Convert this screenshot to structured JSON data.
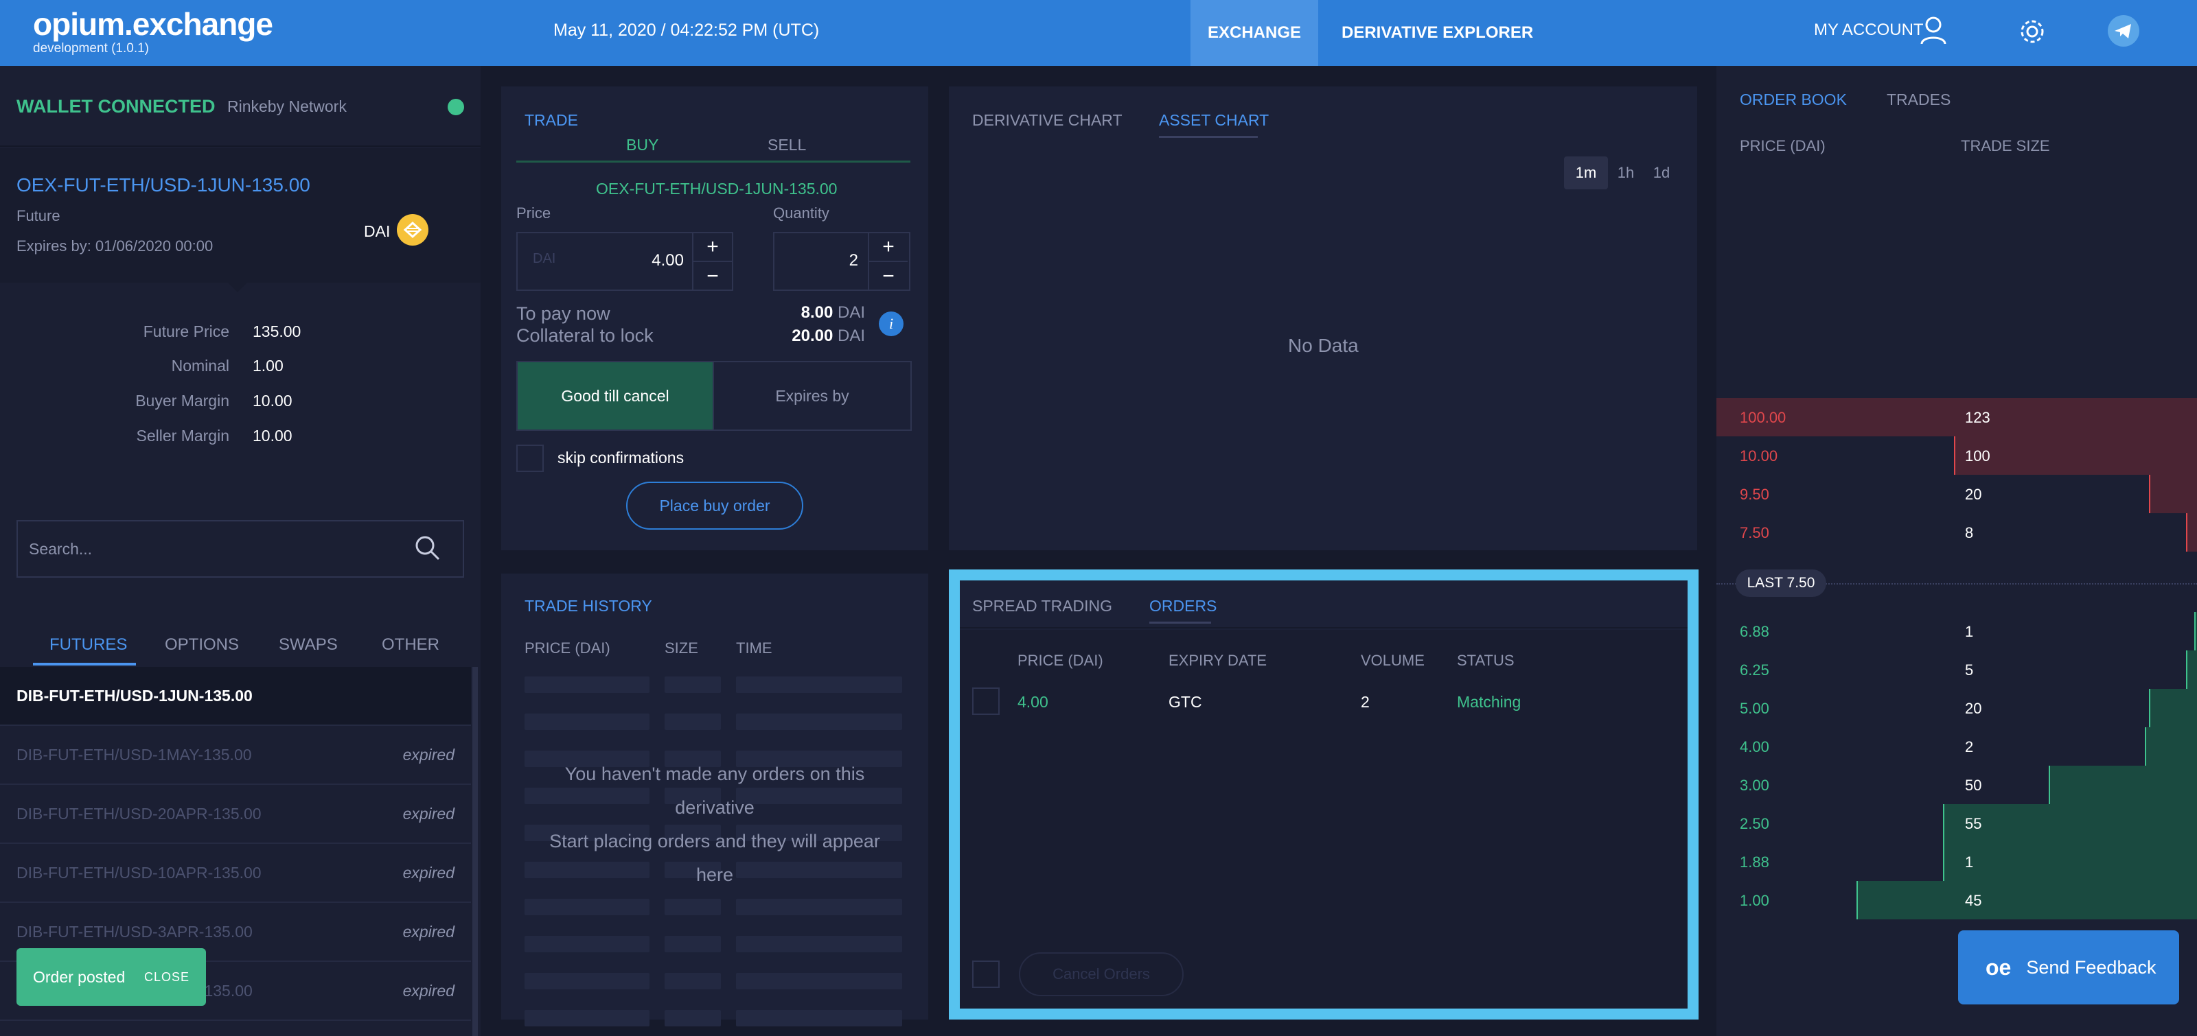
{
  "header": {
    "logo": "opium.exchange",
    "subtitle": "development (1.0.1)",
    "datetime": "May 11, 2020 / 04:22:52 PM (UTC)",
    "nav": [
      "EXCHANGE",
      "DERIVATIVE EXPLORER"
    ],
    "account": "MY ACCOUNT",
    "icons": [
      "user-icon",
      "gear-icon",
      "telegram-icon"
    ]
  },
  "wallet": {
    "status": "WALLET CONNECTED",
    "network": "Rinkeby Network",
    "status_color": "#3fc28d"
  },
  "derivative": {
    "name": "OEX-FUT-ETH/USD-1JUN-135.00",
    "type": "Future",
    "expiry": "Expires by: 01/06/2020 00:00",
    "currency": "DAI",
    "details": [
      {
        "label": "Future Price",
        "value": "135.00"
      },
      {
        "label": "Nominal",
        "value": "1.00"
      },
      {
        "label": "Buyer Margin",
        "value": "10.00"
      },
      {
        "label": "Seller Margin",
        "value": "10.00"
      }
    ]
  },
  "search": {
    "placeholder": "Search..."
  },
  "categories": [
    "FUTURES",
    "OPTIONS",
    "SWAPS",
    "OTHER"
  ],
  "derivative_list": [
    {
      "name": "DIB-FUT-ETH/USD-1JUN-135.00",
      "status": ""
    },
    {
      "name": "DIB-FUT-ETH/USD-1MAY-135.00",
      "status": "expired"
    },
    {
      "name": "DIB-FUT-ETH/USD-20APR-135.00",
      "status": "expired"
    },
    {
      "name": "DIB-FUT-ETH/USD-10APR-135.00",
      "status": "expired"
    },
    {
      "name": "DIB-FUT-ETH/USD-3APR-135.00",
      "status": "expired"
    },
    {
      "name": "DIB-FUT-ETH/USD-1APR-135.00",
      "status": "expired"
    }
  ],
  "toast": {
    "message": "Order posted",
    "close": "CLOSE"
  },
  "trade": {
    "title": "TRADE",
    "tabs": [
      "BUY",
      "SELL"
    ],
    "derivative": "OEX-FUT-ETH/USD-1JUN-135.00",
    "price_label": "Price",
    "quantity_label": "Quantity",
    "price_unit": "DAI",
    "price_value": "4.00",
    "quantity_value": "2",
    "to_pay_label": "To pay now",
    "collateral_label": "Collateral to lock",
    "to_pay_value": "8.00",
    "collateral_value": "20.00",
    "unit": "DAI",
    "tif_options": [
      "Good till cancel",
      "Expires by"
    ],
    "skip_label": "skip confirmations",
    "place_button": "Place buy order"
  },
  "chart": {
    "tabs": [
      "DERIVATIVE CHART",
      "ASSET CHART"
    ],
    "timeframes": [
      "1m",
      "1h",
      "1d"
    ],
    "selected_timeframe": "1m",
    "empty": "No Data"
  },
  "history": {
    "title": "TRADE HISTORY",
    "columns": [
      "PRICE (DAI)",
      "SIZE",
      "TIME"
    ],
    "empty_line1": "You haven't made any orders on this derivative",
    "empty_line2": "Start placing orders and they will appear here"
  },
  "orders": {
    "tabs": [
      "SPREAD TRADING",
      "ORDERS"
    ],
    "columns": [
      "PRICE (DAI)",
      "EXPIRY DATE",
      "VOLUME",
      "STATUS"
    ],
    "rows": [
      {
        "price": "4.00",
        "expiry": "GTC",
        "volume": "2",
        "status": "Matching"
      }
    ],
    "cancel_button": "Cancel Orders"
  },
  "order_book": {
    "tabs": [
      "ORDER BOOK",
      "TRADES"
    ],
    "columns": [
      "PRICE (DAI)",
      "TRADE SIZE"
    ],
    "asks": [
      {
        "price": "100.00",
        "size": "123"
      },
      {
        "price": "10.00",
        "size": "100"
      },
      {
        "price": "9.50",
        "size": "20"
      },
      {
        "price": "7.50",
        "size": "8"
      }
    ],
    "last": "LAST 7.50",
    "bids": [
      {
        "price": "6.88",
        "size": "1"
      },
      {
        "price": "6.25",
        "size": "5"
      },
      {
        "price": "5.00",
        "size": "20"
      },
      {
        "price": "4.00",
        "size": "2"
      },
      {
        "price": "3.00",
        "size": "50"
      },
      {
        "price": "2.50",
        "size": "55"
      },
      {
        "price": "1.88",
        "size": "1"
      },
      {
        "price": "1.00",
        "size": "45"
      }
    ]
  },
  "feedback": {
    "logo": "oe",
    "label": "Send Feedback"
  },
  "colors": {
    "accent": "#2d7ed8",
    "buy": "#3fc28d",
    "sell": "#e0474c",
    "highlight": "#57c3ef"
  }
}
